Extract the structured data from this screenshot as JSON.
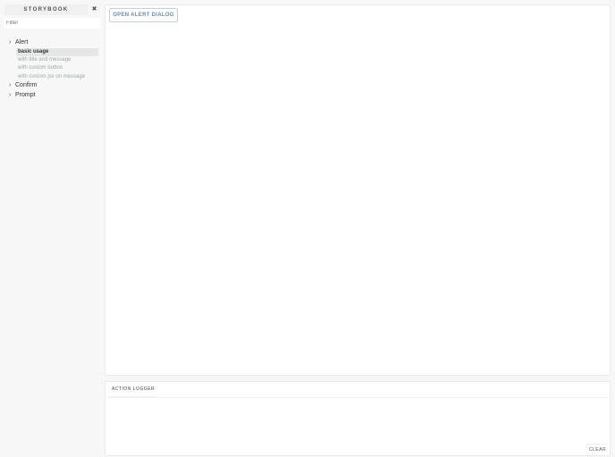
{
  "sidebar": {
    "title": "STORYBOOK",
    "close_icon": "✖",
    "filter_placeholder": "Filter",
    "kinds": [
      {
        "label": "Alert",
        "stories": [
          "basic usage",
          "with title and message",
          "with custom button",
          "with custom jsx on message"
        ]
      },
      {
        "label": "Confirm"
      },
      {
        "label": "Prompt"
      }
    ],
    "chevron": "›"
  },
  "preview": {
    "button_label": "OPEN ALERT DIALOG"
  },
  "panel": {
    "tab_label": "ACTION LOGGER",
    "clear_label": "CLEAR"
  }
}
